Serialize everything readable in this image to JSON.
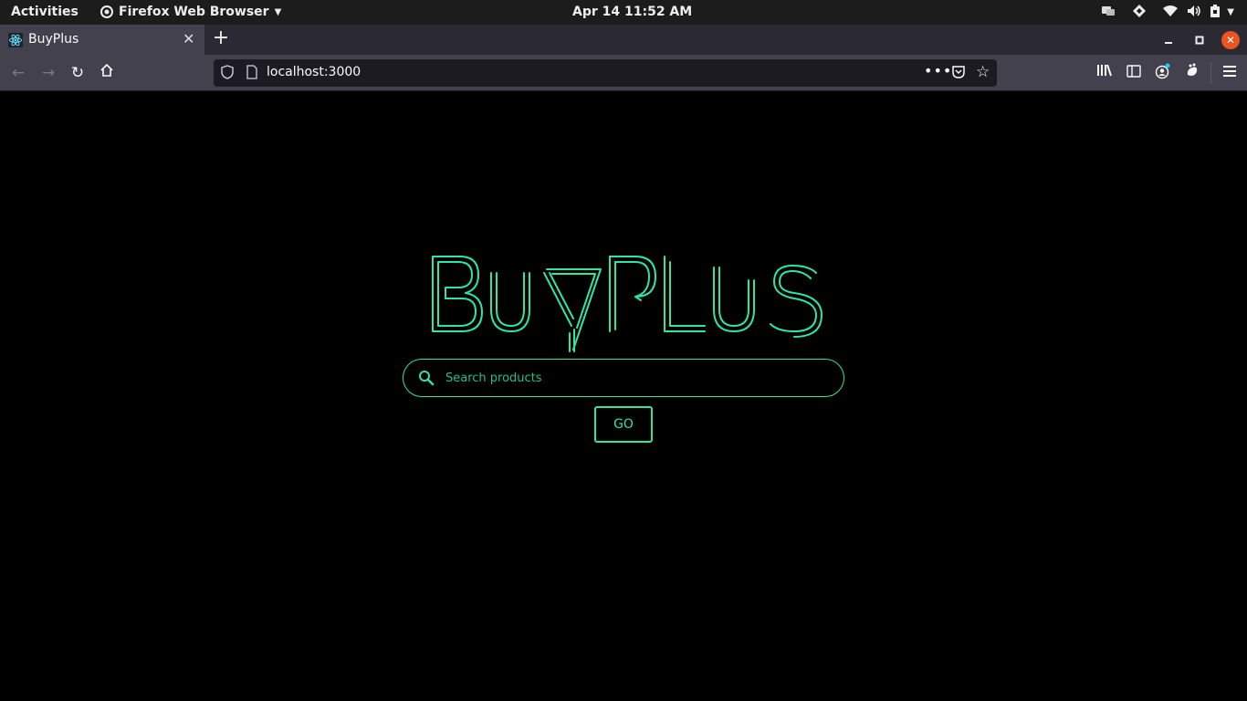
{
  "system_bar": {
    "activities_label": "Activities",
    "app_name": "Firefox Web Browser",
    "datetime": "Apr 14  11:52 AM"
  },
  "browser": {
    "tab_title": "BuyPlus",
    "url": "localhost:3000"
  },
  "page": {
    "logo_text": "BuyPlus",
    "search_placeholder": "Search products",
    "go_label": "GO"
  },
  "colors": {
    "accent": "#2de5a8",
    "background": "#000000",
    "close_button": "#e95420"
  },
  "icons": {
    "tray": [
      "display-settings-icon",
      "diamond-icon",
      "wifi-icon",
      "volume-icon",
      "battery-icon"
    ],
    "toolbar": [
      "library-icon",
      "sidebar-icon",
      "account-icon",
      "extension-icon",
      "menu-icon"
    ]
  }
}
